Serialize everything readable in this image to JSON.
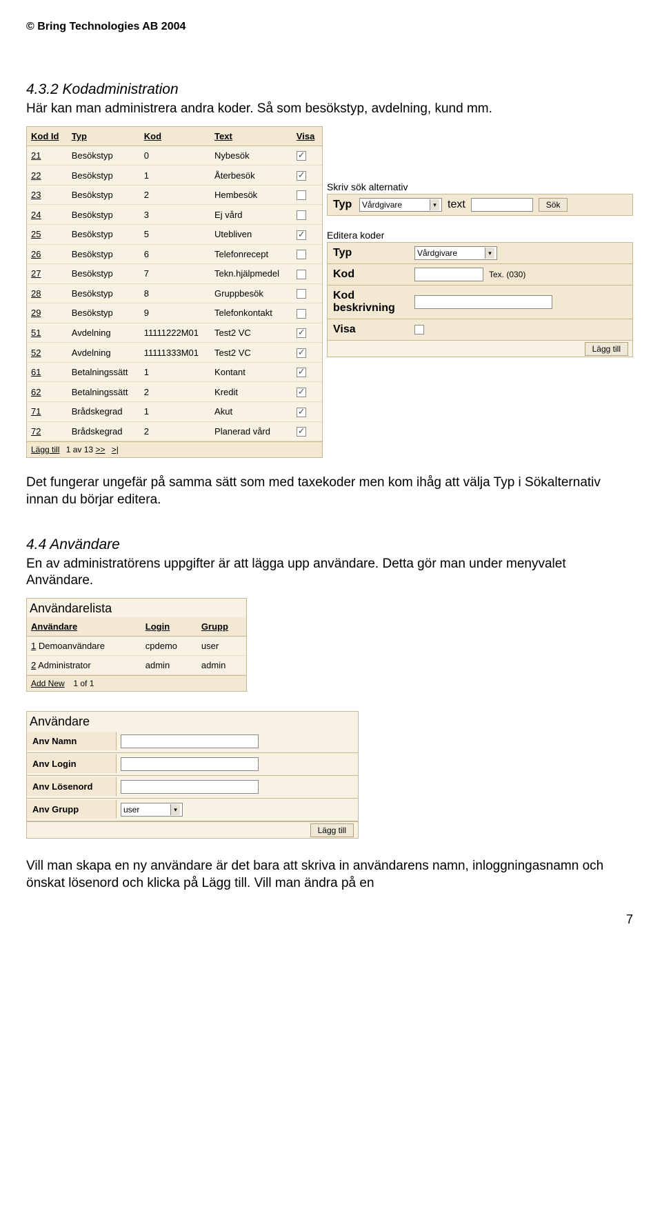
{
  "copyright": "© Bring Technologies AB 2004",
  "section432": {
    "heading": "4.3.2 Kodadministration",
    "intro": "Här kan man administrera andra koder. Så som besökstyp, avdelning, kund mm."
  },
  "codeTable": {
    "headers": [
      "Kod Id",
      "Typ",
      "Kod",
      "Text",
      "Visa"
    ],
    "rows": [
      {
        "id": "21",
        "typ": "Besökstyp",
        "kod": "0",
        "text": "Nybesök",
        "visa": true
      },
      {
        "id": "22",
        "typ": "Besökstyp",
        "kod": "1",
        "text": "Återbesök",
        "visa": true
      },
      {
        "id": "23",
        "typ": "Besökstyp",
        "kod": "2",
        "text": "Hembesök",
        "visa": false
      },
      {
        "id": "24",
        "typ": "Besökstyp",
        "kod": "3",
        "text": "Ej vård",
        "visa": false
      },
      {
        "id": "25",
        "typ": "Besökstyp",
        "kod": "5",
        "text": "Utebliven",
        "visa": true
      },
      {
        "id": "26",
        "typ": "Besökstyp",
        "kod": "6",
        "text": "Telefonrecept",
        "visa": false
      },
      {
        "id": "27",
        "typ": "Besökstyp",
        "kod": "7",
        "text": "Tekn.hjälpmedel",
        "visa": false
      },
      {
        "id": "28",
        "typ": "Besökstyp",
        "kod": "8",
        "text": "Gruppbesök",
        "visa": false
      },
      {
        "id": "29",
        "typ": "Besökstyp",
        "kod": "9",
        "text": "Telefonkontakt",
        "visa": false
      },
      {
        "id": "51",
        "typ": "Avdelning",
        "kod": "11111222M01",
        "text": "Test2 VC",
        "visa": true
      },
      {
        "id": "52",
        "typ": "Avdelning",
        "kod": "11111333M01",
        "text": "Test2 VC",
        "visa": true
      },
      {
        "id": "61",
        "typ": "Betalningssätt",
        "kod": "1",
        "text": "Kontant",
        "visa": true
      },
      {
        "id": "62",
        "typ": "Betalningssätt",
        "kod": "2",
        "text": "Kredit",
        "visa": true
      },
      {
        "id": "71",
        "typ": "Brådskegrad",
        "kod": "1",
        "text": "Akut",
        "visa": true
      },
      {
        "id": "72",
        "typ": "Brådskegrad",
        "kod": "2",
        "text": "Planerad vård",
        "visa": true
      }
    ],
    "footer": {
      "add": "Lägg till",
      "page": "1 av 13",
      "next": ">>",
      "last": ">|"
    }
  },
  "searchPanel": {
    "title": "Skriv sök alternativ",
    "typLabel": "Typ",
    "typValue": "Vårdgivare",
    "textLabel": "text",
    "sokBtn": "Sök"
  },
  "editPanel": {
    "title": "Editera koder",
    "typLabel": "Typ",
    "typValue": "Vårdgivare",
    "kodLabel": "Kod",
    "kodHint": "Tex. (030)",
    "kodBeskLabel": "Kod beskrivning",
    "visaLabel": "Visa",
    "addBtn": "Lägg till"
  },
  "paraAfter": "Det fungerar ungefär på samma sätt som med taxekoder men kom ihåg att välja Typ i Sökalternativ innan du börjar editera.",
  "section44": {
    "heading": "4.4 Användare",
    "intro": "En av administratörens uppgifter är att lägga upp användare. Detta gör man under menyvalet Användare."
  },
  "userList": {
    "title": "Användarelista",
    "headers": [
      "Användare",
      "Login",
      "Grupp"
    ],
    "rows": [
      {
        "id": "1",
        "name": "Demoanvändare",
        "login": "cpdemo",
        "grupp": "user"
      },
      {
        "id": "2",
        "name": "Administrator",
        "login": "admin",
        "grupp": "admin"
      }
    ],
    "footer": {
      "add": "Add New",
      "page": "1 of 1"
    }
  },
  "userForm": {
    "title": "Användare",
    "namnLabel": "Anv Namn",
    "loginLabel": "Anv Login",
    "losenLabel": "Anv Lösenord",
    "gruppLabel": "Anv Grupp",
    "gruppValue": "user",
    "addBtn": "Lägg till"
  },
  "paraBottom": "Vill man skapa en ny användare är det bara att skriva in användarens namn, inloggningasnamn och önskat lösenord och klicka på Lägg till. Vill man ändra på en",
  "pageNumber": "7"
}
